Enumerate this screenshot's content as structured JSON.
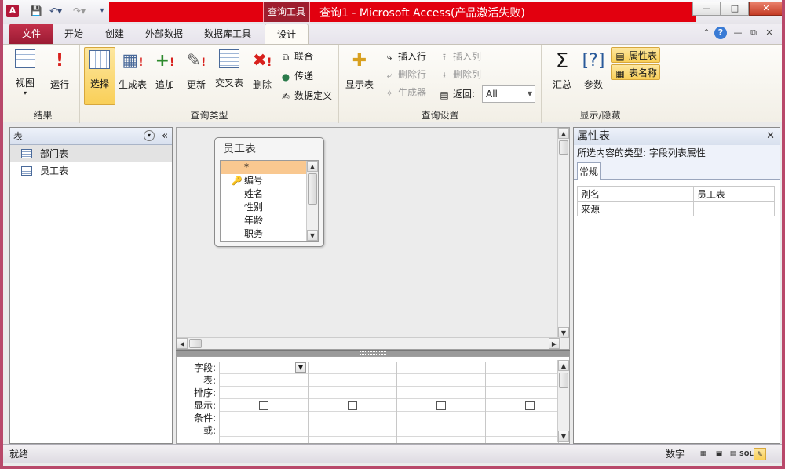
{
  "titlebar": {
    "app_icon": "A",
    "context_tools": "查询工具",
    "window_title": "查询1 - Microsoft Access(产品激活失败)",
    "accent_color": "#e2000f"
  },
  "tabs": {
    "file": "文件",
    "home": "开始",
    "create": "创建",
    "external": "外部数据",
    "dbtools": "数据库工具",
    "design": "设计"
  },
  "ribbon": {
    "results": {
      "label": "结果",
      "view": "视图",
      "run": "运行"
    },
    "query_type": {
      "label": "查询类型",
      "select": "选择",
      "make_table": "生成表",
      "append": "追加",
      "update": "更新",
      "crosstab": "交叉表",
      "delete": "删除",
      "union": "联合",
      "passthrough": "传递",
      "data_definition": "数据定义"
    },
    "query_setup": {
      "label": "查询设置",
      "show_table": "显示表",
      "insert_rows": "插入行",
      "delete_rows": "删除行",
      "builder": "生成器",
      "insert_cols": "插入列",
      "delete_cols": "删除列",
      "return_label": "返回:",
      "return_value": "All"
    },
    "show_hide": {
      "label": "显示/隐藏",
      "totals": "汇总",
      "parameters": "参数",
      "property_sheet": "属性表",
      "table_names": "表名称"
    }
  },
  "nav": {
    "header": "表",
    "items": [
      "部门表",
      "员工表"
    ]
  },
  "fieldlist": {
    "title": "员工表",
    "fields": [
      "*",
      "编号",
      "姓名",
      "性别",
      "年龄",
      "职务"
    ]
  },
  "qbe": {
    "row_labels": [
      "字段:",
      "表:",
      "排序:",
      "显示:",
      "条件:",
      "或:"
    ]
  },
  "propsheet": {
    "title": "属性表",
    "type_label": "所选内容的类型: 字段列表属性",
    "tab_general": "常规",
    "rows": [
      {
        "name": "别名",
        "value": "员工表"
      },
      {
        "name": "来源",
        "value": ""
      }
    ]
  },
  "status": {
    "left": "就绪",
    "mode": "数字",
    "sql": "SQL"
  }
}
